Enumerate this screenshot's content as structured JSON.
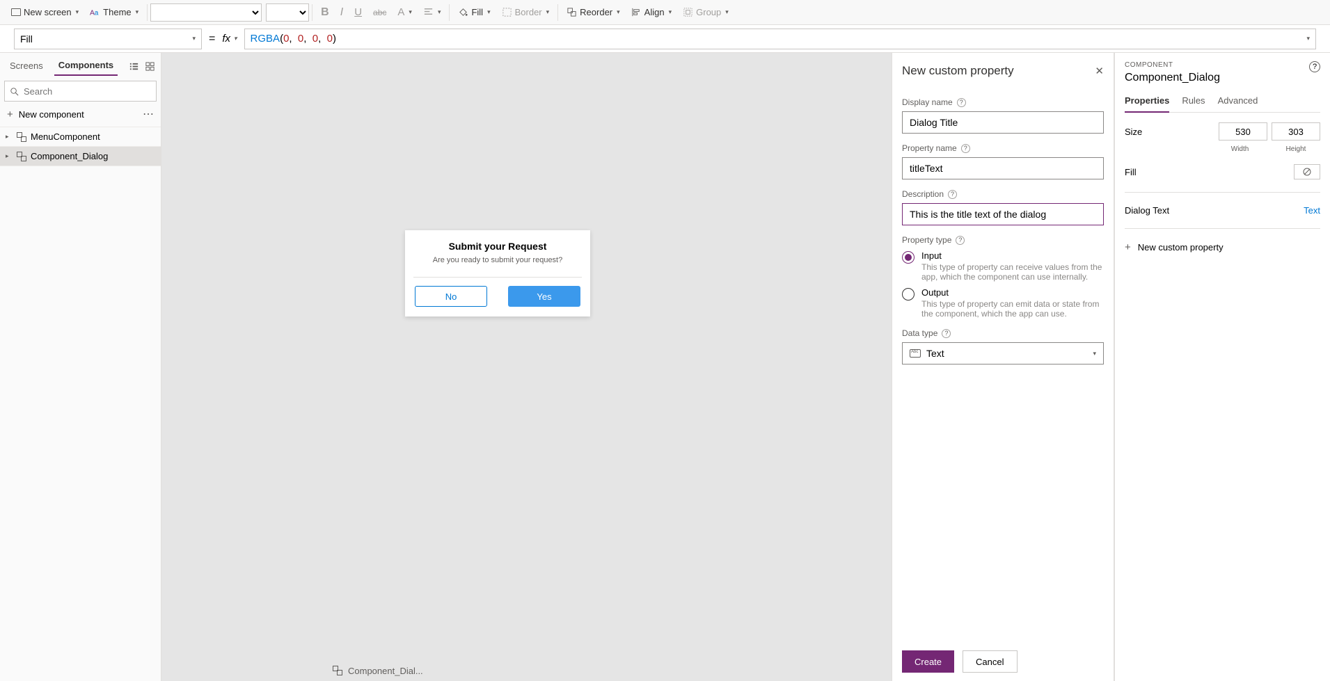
{
  "ribbon": {
    "newScreen": "New screen",
    "theme": "Theme",
    "fill": "Fill",
    "border": "Border",
    "reorder": "Reorder",
    "align": "Align",
    "group": "Group"
  },
  "formulaBar": {
    "propertyName": "Fill",
    "equals": "=",
    "fx": "fx",
    "formula_fn": "RGBA",
    "formula_args": [
      "0",
      "0",
      "0",
      "0"
    ]
  },
  "leftPane": {
    "tabs": {
      "screens": "Screens",
      "components": "Components"
    },
    "searchPlaceholder": "Search",
    "newComponent": "New component",
    "items": [
      {
        "name": "MenuComponent"
      },
      {
        "name": "Component_Dialog"
      }
    ]
  },
  "canvas": {
    "dialog": {
      "title": "Submit your Request",
      "message": "Are you ready to submit your request?",
      "noLabel": "No",
      "yesLabel": "Yes"
    }
  },
  "footer": {
    "breadcrumb": "Component_Dial..."
  },
  "propPanel": {
    "title": "New custom property",
    "displayName": {
      "label": "Display name",
      "value": "Dialog Title"
    },
    "propertyName": {
      "label": "Property name",
      "value": "titleText"
    },
    "description": {
      "label": "Description",
      "value": "This is the title text of the dialog"
    },
    "propertyType": {
      "label": "Property type",
      "input": {
        "label": "Input",
        "desc": "This type of property can receive values from the app, which the component can use internally."
      },
      "output": {
        "label": "Output",
        "desc": "This type of property can emit data or state from the component, which the app can use."
      }
    },
    "dataType": {
      "label": "Data type",
      "value": "Text"
    },
    "createBtn": "Create",
    "cancelBtn": "Cancel"
  },
  "rightPanel": {
    "sectionLabel": "COMPONENT",
    "name": "Component_Dialog",
    "tabs": {
      "properties": "Properties",
      "rules": "Rules",
      "advanced": "Advanced"
    },
    "size": {
      "label": "Size",
      "width": "530",
      "height": "303",
      "wLabel": "Width",
      "hLabel": "Height"
    },
    "fillLabel": "Fill",
    "dialogTextLabel": "Dialog Text",
    "dialogTextType": "Text",
    "newCustomProp": "New custom property"
  }
}
